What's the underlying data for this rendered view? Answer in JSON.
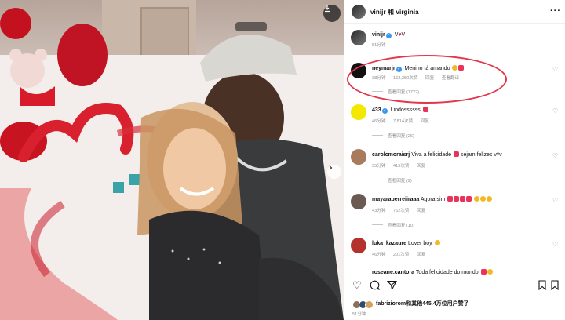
{
  "post": {
    "header_title": "vinijr 和 virginia",
    "caption_user": "vinijr",
    "caption_text": "V",
    "caption_text_end": "V",
    "caption_time": "51分钟"
  },
  "comments": [
    {
      "user": "neymarjr",
      "verified": true,
      "text": "Menino tá amando",
      "time": "38分钟",
      "likes": "162,350次赞",
      "reply": "回复",
      "translate": "查看翻译",
      "view_replies": "查看回复 (7722)"
    },
    {
      "user": "433",
      "verified": true,
      "text": "Lindossssss",
      "time": "46分钟",
      "likes": "7,814次赞",
      "reply": "回复",
      "view_replies": "查看回复 (26)"
    },
    {
      "user": "carolcmoraisrj",
      "verified": false,
      "text": "Viva a felicidade",
      "text2": "sejam felizes v^v",
      "time": "35分钟",
      "likes": "415次赞",
      "reply": "回复",
      "view_replies": "查看回复 (2)"
    },
    {
      "user": "mayaraperreiiraaa",
      "verified": false,
      "text": "Agora sim",
      "time": "43分钟",
      "likes": "762次赞",
      "reply": "回复",
      "view_replies": "查看回复 (10)"
    },
    {
      "user": "luka_kazaure",
      "verified": false,
      "text": "Lover boy",
      "time": "46分钟",
      "likes": "201次赞",
      "reply": "回复"
    },
    {
      "user": "roseane.cantora",
      "verified": false,
      "text": "Toda felicidade do mundo"
    }
  ],
  "footer": {
    "likes_user": "fabriziorom",
    "likes_rest": "和其他445.4万位用户赞了",
    "time": "51分钟"
  },
  "colors": {
    "highlight": "#e0374a",
    "verified": "#3897f0",
    "muted": "#8e8e8e"
  },
  "icons": [
    "download-icon",
    "chevron-right-icon",
    "more-icon",
    "heart-icon",
    "comment-icon",
    "share-icon",
    "bookmark-icon"
  ]
}
